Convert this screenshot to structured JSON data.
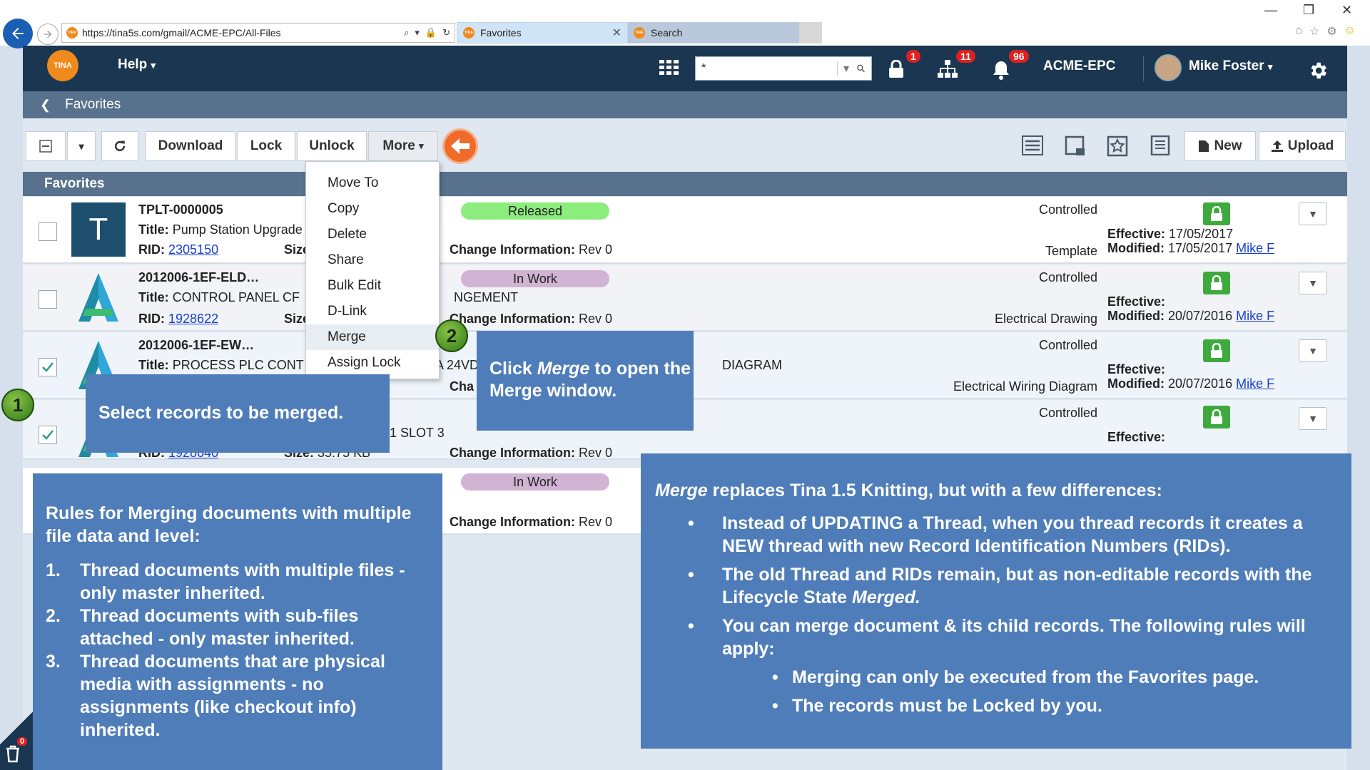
{
  "browser": {
    "url": "https://tina5s.com/gmail/ACME-EPC/All-Files",
    "tabs": [
      {
        "label": "Favorites"
      },
      {
        "label": "Search"
      }
    ],
    "favicon_text": "TINA"
  },
  "header": {
    "logo_text": "TINA",
    "help_label": "Help",
    "search_value": "*",
    "badges": {
      "lock": "1",
      "tree": "11",
      "bell": "96"
    },
    "org": "ACME-EPC",
    "user": "Mike Foster"
  },
  "breadcrumb": {
    "label": "Favorites"
  },
  "toolbar": {
    "download": "Download",
    "lock": "Lock",
    "unlock": "Unlock",
    "more": "More",
    "new": "New",
    "upload": "Upload"
  },
  "favorites": {
    "heading": "Favorites",
    "labels": {
      "title": "Title:",
      "rid": "RID:",
      "size": "Size:",
      "change": "Change Information:",
      "effective": "Effective:",
      "modified": "Modified:"
    },
    "rows": [
      {
        "name": "TPLT-0000005",
        "thumb": "T",
        "title": "Pump Station Upgrade",
        "rid": "2305150",
        "status": "Released",
        "change": "Rev 0",
        "control": "Controlled",
        "category": "Template",
        "effective": "17/05/2017",
        "modified": "17/05/2017",
        "modified_by": "Mike F"
      },
      {
        "name": "2012006-1EF-ELD…",
        "title": "CONTROL PANEL CF",
        "title_tail": "NGEMENT",
        "rid": "1928622",
        "status": "In Work",
        "change": "Rev 0",
        "control": "Controlled",
        "category": "Electrical Drawing",
        "effective": "",
        "modified": "20/07/2016",
        "modified_by": "Mike F"
      },
      {
        "name": "2012006-1EF-EW…",
        "title": "PROCESS PLC CONT",
        "title_mid": "A 24VD",
        "title_tail": "DIAGRAM",
        "change_partial": "Cha",
        "control": "Controlled",
        "category": "Electrical Wiring Diagram",
        "effective": "",
        "modified": "20/07/2016",
        "modified_by": "Mike F"
      },
      {
        "title_mid": "1 SLOT 3",
        "rid": "1928640",
        "size": "35.75 KB",
        "change": "Rev 0",
        "control": "Controlled",
        "effective": ""
      },
      {
        "status": "In Work",
        "change": "Rev 0"
      }
    ]
  },
  "more_menu": {
    "items": [
      "Move To",
      "Copy",
      "Delete",
      "Share",
      "Bulk Edit",
      "D-Link",
      "Merge",
      "Assign Lock"
    ]
  },
  "callouts": {
    "step1_num": "1",
    "step1_text": "Select records to be merged.",
    "step2_num": "2",
    "step2_pre": "Click ",
    "step2_em": "Merge",
    "step2_post": " to open the Merge window.",
    "rules_title": "Rules for Merging documents with multiple file data and level:",
    "rules": [
      "Thread documents with multiple files - only master inherited.",
      "Thread documents with sub-files attached - only master inherited.",
      "Thread documents that are physical media with assignments - no assignments (like checkout info) inherited."
    ],
    "merge_em": "Merge",
    "merge_title_rest": " replaces Tina 1.5 Knitting, but  with a few differences:",
    "merge_bullet1": "Instead of UPDATING a Thread, when you thread records it creates a NEW  thread with new Record Identification Numbers (RIDs).",
    "merge_bullet2_pre": "The old Thread and RIDs remain, but  as non-editable records with the Lifecycle State ",
    "merge_bullet2_em": "Merged.",
    "merge_bullet3": "You can merge document & its child records. The following rules will apply:",
    "merge_sub": [
      "Merging can only be executed from the Favorites page.",
      "The records must be Locked by you."
    ]
  },
  "trash_badge": "0",
  "colors": {
    "header_bg": "#1b3650",
    "subbar_bg": "#58718c",
    "callout_bg": "#4f7db9",
    "released": "#8cec7e",
    "inwork": "#d1b3d3",
    "lock_green": "#3eaa3e",
    "accent_orange": "#f06a2a"
  }
}
